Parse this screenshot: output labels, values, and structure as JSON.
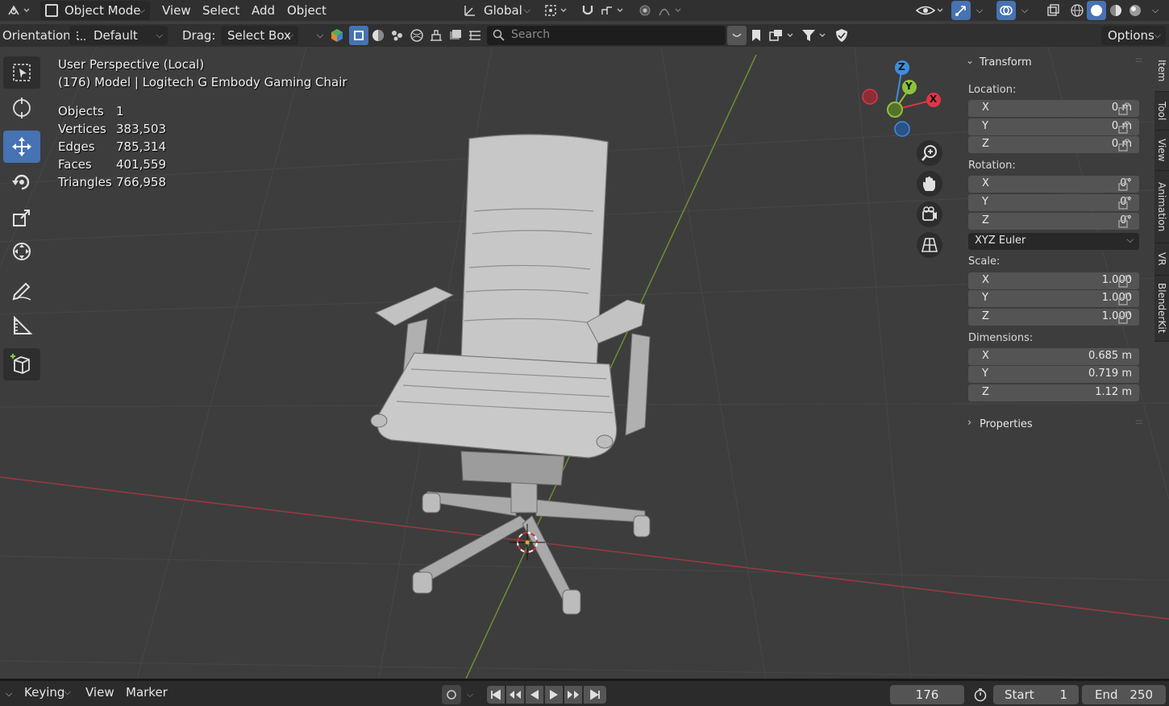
{
  "header": {
    "mode_label": "Object Mode",
    "menus": [
      "View",
      "Select",
      "Add",
      "Object"
    ],
    "transform_orientation": "Global",
    "options_label": "Options"
  },
  "tool_settings": {
    "orientation_label": "Orientation:",
    "orientation_value": "Default",
    "drag_label": "Drag:",
    "drag_value": "Select Box",
    "search_placeholder": "Search"
  },
  "viewport": {
    "perspective": "User Perspective (Local)",
    "frame_info": "(176) Model | Logitech G Embody Gaming Chair",
    "stats": [
      {
        "label": "Objects",
        "value": "1"
      },
      {
        "label": "Vertices",
        "value": "383,503"
      },
      {
        "label": "Edges",
        "value": "785,314"
      },
      {
        "label": "Faces",
        "value": "401,559"
      },
      {
        "label": "Triangles",
        "value": "766,958"
      }
    ],
    "gizmo_axes": {
      "x": "X",
      "y": "Y",
      "z": "Z"
    }
  },
  "sidebar": {
    "transform_title": "Transform",
    "location_label": "Location:",
    "location": [
      {
        "axis": "X",
        "value": "0 m"
      },
      {
        "axis": "Y",
        "value": "0 m"
      },
      {
        "axis": "Z",
        "value": "0 m"
      }
    ],
    "rotation_label": "Rotation:",
    "rotation": [
      {
        "axis": "X",
        "value": "0°"
      },
      {
        "axis": "Y",
        "value": "0°"
      },
      {
        "axis": "Z",
        "value": "0°"
      }
    ],
    "rotation_mode": "XYZ Euler",
    "scale_label": "Scale:",
    "scale": [
      {
        "axis": "X",
        "value": "1.000"
      },
      {
        "axis": "Y",
        "value": "1.000"
      },
      {
        "axis": "Z",
        "value": "1.000"
      }
    ],
    "dimensions_label": "Dimensions:",
    "dimensions": [
      {
        "axis": "X",
        "value": "0.685 m"
      },
      {
        "axis": "Y",
        "value": "0.719 m"
      },
      {
        "axis": "Z",
        "value": "1.12 m"
      }
    ],
    "properties_title": "Properties",
    "tabs": [
      "Item",
      "Tool",
      "View",
      "Animation",
      "VR",
      "BlenderKit"
    ]
  },
  "timeline": {
    "keying_label": "Keying",
    "view_label": "View",
    "marker_label": "Marker",
    "current_frame": "176",
    "start_label": "Start",
    "start_value": "1",
    "end_label": "End",
    "end_value": "250"
  },
  "colors": {
    "accent": "#4772b3",
    "x_axis": "#e03545",
    "y_axis": "#8cc33a",
    "z_axis": "#3d8de0"
  }
}
